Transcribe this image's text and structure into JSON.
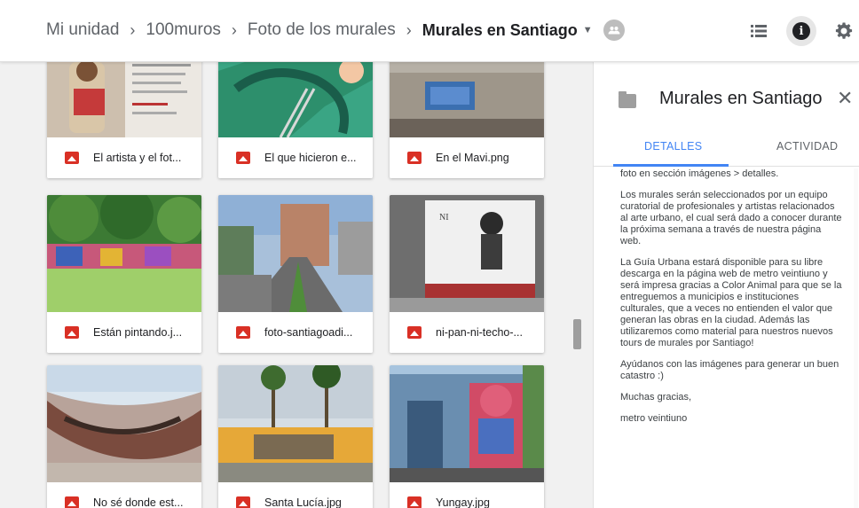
{
  "breadcrumb": {
    "items": [
      "Mi unidad",
      "100muros",
      "Foto de los murales"
    ],
    "current": "Murales en Santiago"
  },
  "toolbar": {
    "icons": [
      "shared-folder-icon",
      "list-view-icon",
      "info-icon",
      "settings-icon"
    ]
  },
  "files": [
    {
      "name": "El artista y el fot..."
    },
    {
      "name": "El que hicieron e..."
    },
    {
      "name": "En el Mavi.png"
    },
    {
      "name": "Están pintando.j..."
    },
    {
      "name": "foto-santiagoadi..."
    },
    {
      "name": "ni-pan-ni-techo-..."
    },
    {
      "name": "No sé donde est..."
    },
    {
      "name": "Santa Lucía.jpg"
    },
    {
      "name": "Yungay.jpg"
    }
  ],
  "details": {
    "title": "Murales en Santiago",
    "tabs": {
      "details": "DETALLES",
      "activity": "ACTIVIDAD"
    },
    "paragraphs": [
      "foto en sección imágenes > detalles.",
      "Los murales serán seleccionados por un equipo curatorial de profesionales y artistas relacionados al arte urbano, el cual será dado a conocer durante la próxima semana a través de nuestra página web.",
      "La Guía Urbana estará disponible para su libre descarga en la página web de metro veintiuno y será impresa gracias a Color Animal para que se la entreguemos a municipios e instituciones culturales, que a veces no entienden el valor que generan las obras en la ciudad. Además las utilizaremos como material para nuestros nuevos tours de murales por Santiago!",
      "Ayúdanos con las imágenes para generar un buen catastro :)",
      "Muchas gracias,",
      "metro veintiuno"
    ]
  },
  "colors": {
    "accent": "#4285f4",
    "image_icon": "#d93025"
  }
}
